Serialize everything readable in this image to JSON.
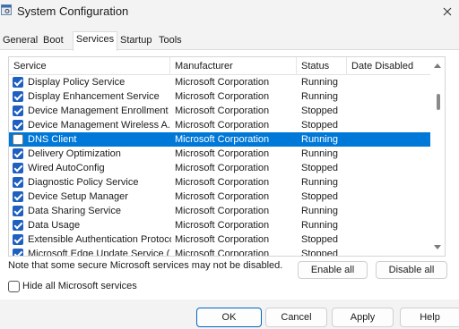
{
  "window": {
    "title": "System Configuration",
    "icon": "settings-window-icon",
    "close_icon": "close-icon"
  },
  "tabs": [
    {
      "label": "General",
      "active": false
    },
    {
      "label": "Boot",
      "active": false
    },
    {
      "label": "Services",
      "active": true
    },
    {
      "label": "Startup",
      "active": false
    },
    {
      "label": "Tools",
      "active": false
    }
  ],
  "list": {
    "headers": {
      "service": "Service",
      "manufacturer": "Manufacturer",
      "status": "Status",
      "date_disabled": "Date Disabled"
    },
    "rows": [
      {
        "checked": true,
        "service": "Display Policy Service",
        "manufacturer": "Microsoft Corporation",
        "status": "Running",
        "date_disabled": ""
      },
      {
        "checked": true,
        "service": "Display Enhancement Service",
        "manufacturer": "Microsoft Corporation",
        "status": "Running",
        "date_disabled": ""
      },
      {
        "checked": true,
        "service": "Device Management Enrollment ...",
        "manufacturer": "Microsoft Corporation",
        "status": "Stopped",
        "date_disabled": ""
      },
      {
        "checked": true,
        "service": "Device Management Wireless A...",
        "manufacturer": "Microsoft Corporation",
        "status": "Stopped",
        "date_disabled": ""
      },
      {
        "checked": false,
        "selected": true,
        "service": "DNS Client",
        "manufacturer": "Microsoft Corporation",
        "status": "Running",
        "date_disabled": ""
      },
      {
        "checked": true,
        "service": "Delivery Optimization",
        "manufacturer": "Microsoft Corporation",
        "status": "Running",
        "date_disabled": ""
      },
      {
        "checked": true,
        "service": "Wired AutoConfig",
        "manufacturer": "Microsoft Corporation",
        "status": "Stopped",
        "date_disabled": ""
      },
      {
        "checked": true,
        "service": "Diagnostic Policy Service",
        "manufacturer": "Microsoft Corporation",
        "status": "Running",
        "date_disabled": ""
      },
      {
        "checked": true,
        "service": "Device Setup Manager",
        "manufacturer": "Microsoft Corporation",
        "status": "Stopped",
        "date_disabled": ""
      },
      {
        "checked": true,
        "service": "Data Sharing Service",
        "manufacturer": "Microsoft Corporation",
        "status": "Running",
        "date_disabled": ""
      },
      {
        "checked": true,
        "service": "Data Usage",
        "manufacturer": "Microsoft Corporation",
        "status": "Running",
        "date_disabled": ""
      },
      {
        "checked": true,
        "service": "Extensible Authentication Protocol",
        "manufacturer": "Microsoft Corporation",
        "status": "Stopped",
        "date_disabled": ""
      },
      {
        "checked": true,
        "service": "Microsoft Edge Update Service (",
        "manufacturer": "Microsoft Corporation",
        "status": "Stopped",
        "date_disabled": ""
      }
    ]
  },
  "note": "Note that some secure Microsoft services may not be disabled.",
  "buttons": {
    "enable_all": "Enable all",
    "disable_all": "Disable all",
    "ok": "OK",
    "cancel": "Cancel",
    "apply": "Apply",
    "help": "Help"
  },
  "hide_ms": {
    "label": "Hide all Microsoft services",
    "checked": false
  },
  "colors": {
    "selection": "#0078d7",
    "checkbox": "#1f5fbf",
    "accent_border": "#0067c0"
  }
}
